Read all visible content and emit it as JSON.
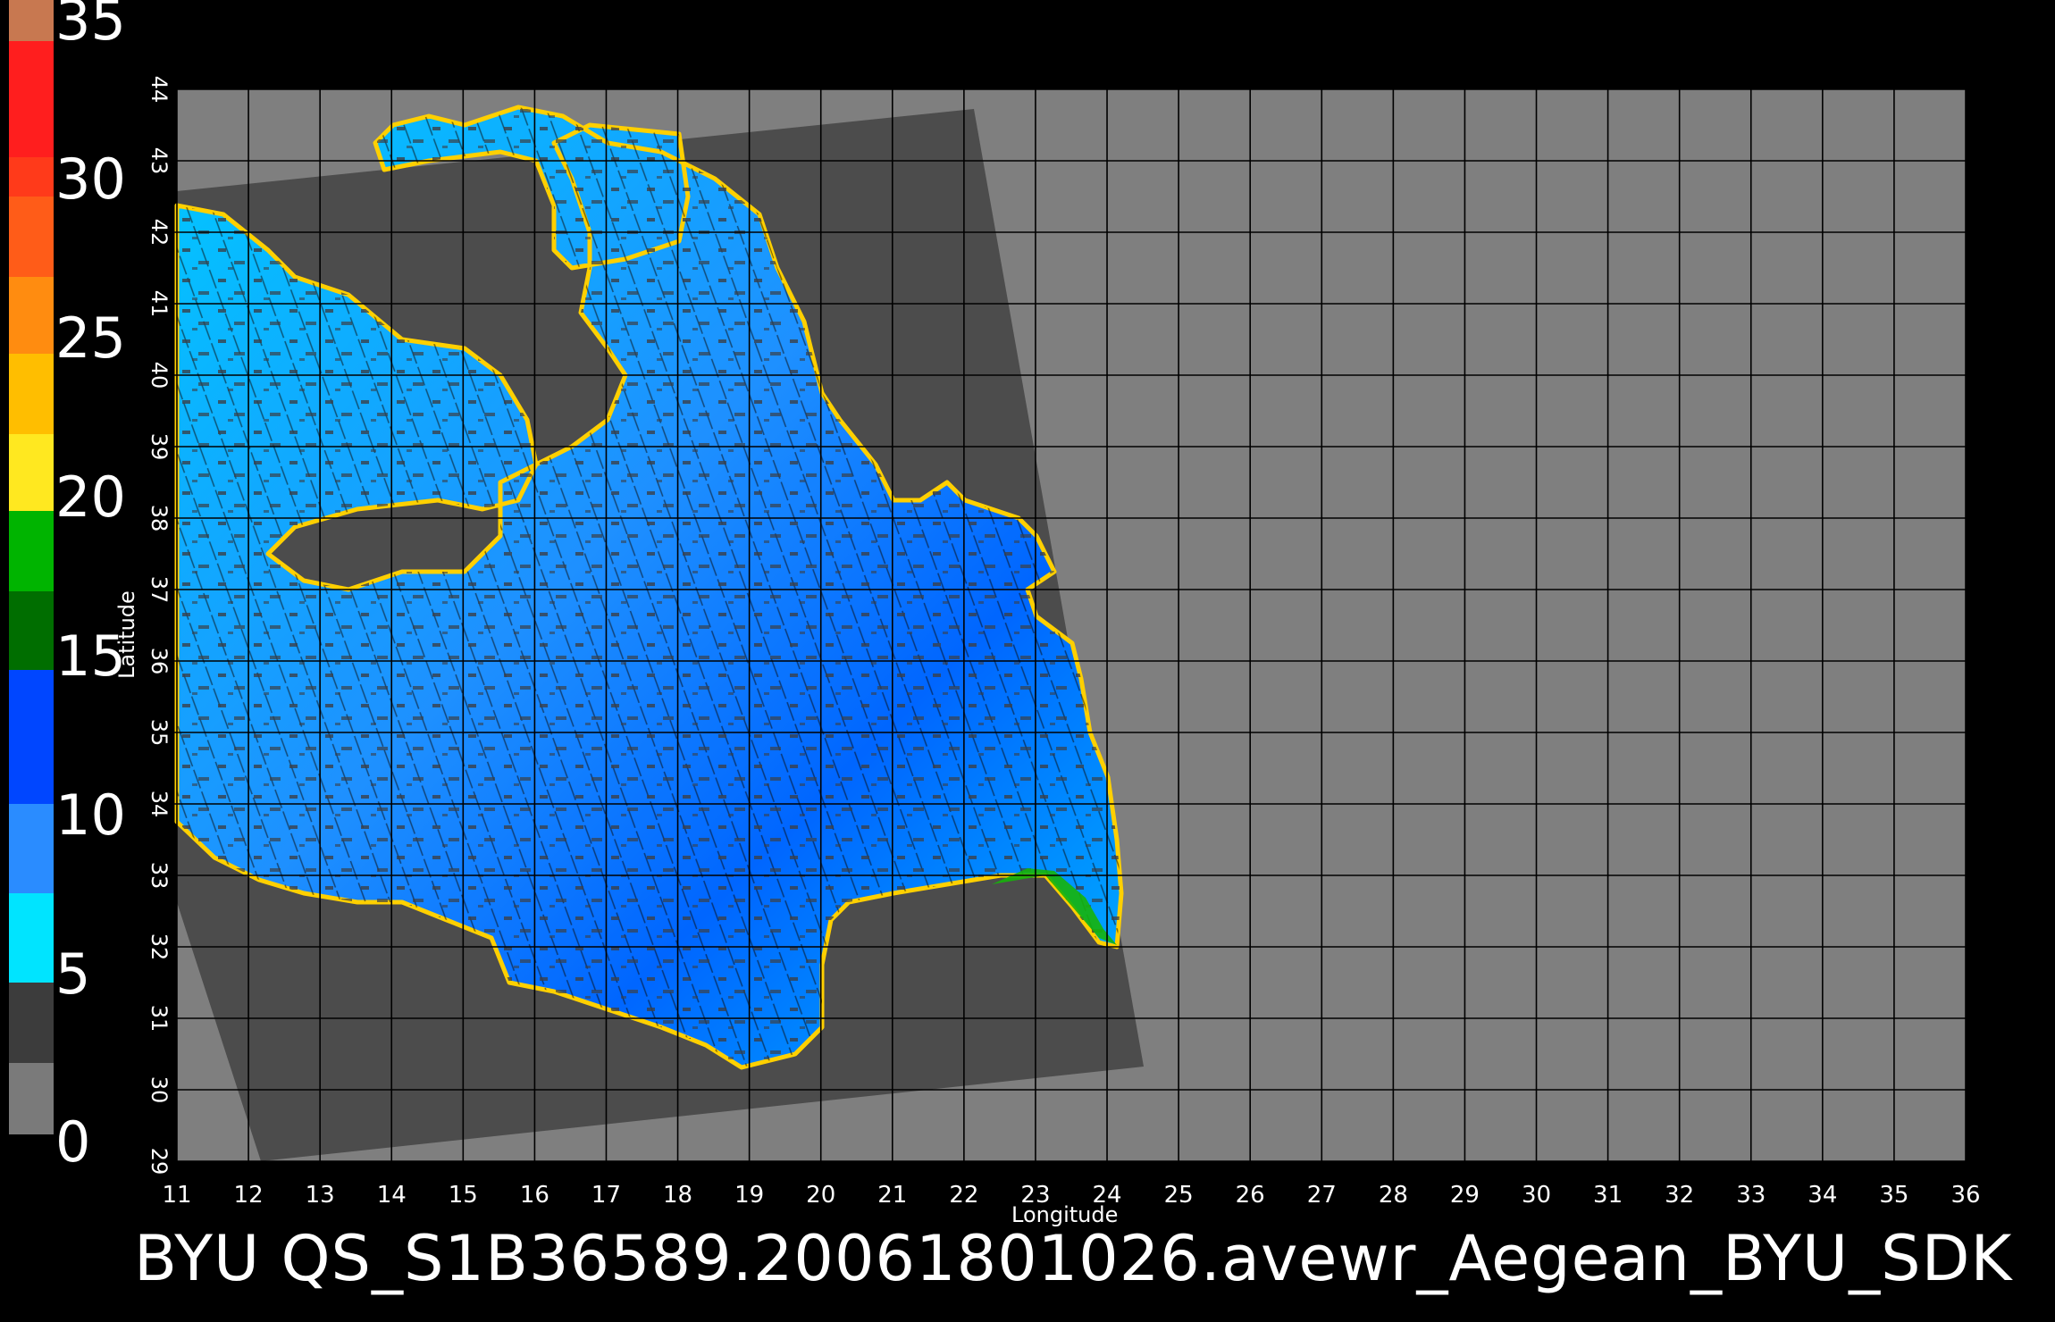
{
  "colorbar": {
    "labels": [
      "35",
      "30",
      "25",
      "20",
      "15",
      "10",
      "5",
      "0"
    ],
    "colors": [
      "#c87850",
      "#ff1e1e",
      "#ff3a1a",
      "#ff7a14",
      "#ffae00",
      "#ffe020",
      "#00c000",
      "#007800",
      "#0050ff",
      "#2e8cff",
      "#00e8ff",
      "#505050",
      "#707070"
    ]
  },
  "map": {
    "longitude_ticks": [
      "11",
      "12",
      "13",
      "14",
      "15",
      "16",
      "17",
      "18",
      "19",
      "20",
      "21",
      "22",
      "23",
      "24",
      "25",
      "26",
      "27",
      "28",
      "29",
      "30",
      "31",
      "32",
      "33",
      "34",
      "35",
      "36"
    ],
    "latitude_ticks": [
      "29",
      "30",
      "31",
      "32",
      "33",
      "34",
      "35",
      "36",
      "37",
      "38",
      "39",
      "40",
      "41",
      "42",
      "43",
      "44"
    ],
    "x_label": "Longitude",
    "y_label": "Latitude",
    "background_color": "#7f7f7f",
    "swath_color": "#4c4c4c",
    "ocean_color": "#1e90ff",
    "gridline_color": "#000000"
  },
  "footer": {
    "title": "BYU  QS_S1B36589.20061801026.avewr_Aegean_BYU_SDK"
  }
}
